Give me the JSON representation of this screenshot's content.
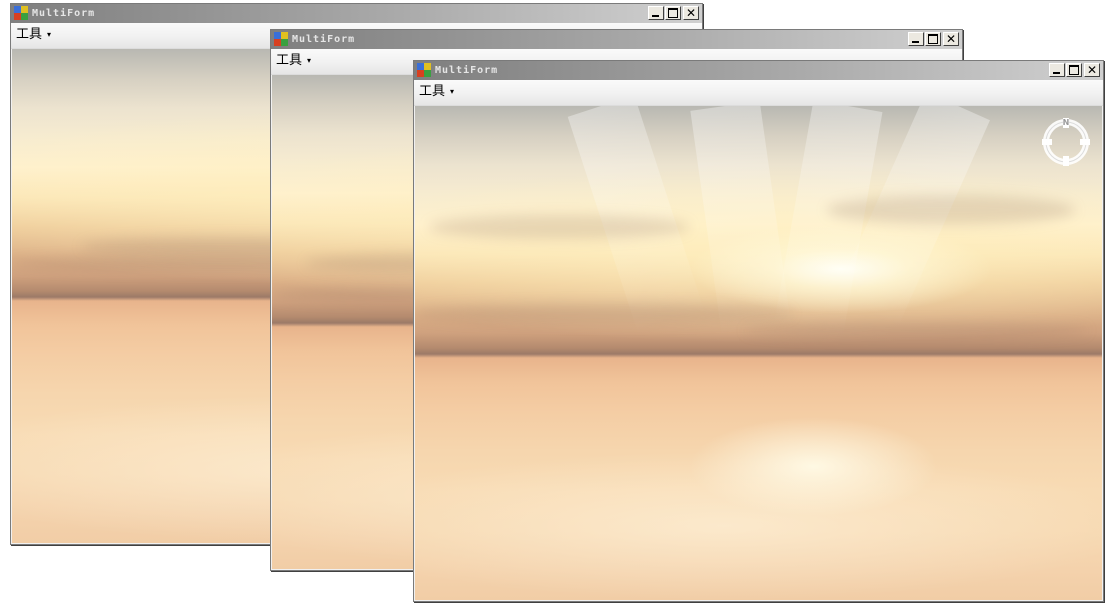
{
  "windows": [
    {
      "title": "MultiForm",
      "menu": {
        "tools_label": "工具"
      },
      "controls": {
        "minimize_glyph": "_",
        "maximize_glyph": "□",
        "close_glyph": "✕"
      }
    },
    {
      "title": "MultiForm",
      "menu": {
        "tools_label": "工具"
      },
      "controls": {
        "minimize_glyph": "_",
        "maximize_glyph": "□",
        "close_glyph": "✕"
      }
    },
    {
      "title": "MultiForm",
      "menu": {
        "tools_label": "工具"
      },
      "controls": {
        "minimize_glyph": "_",
        "maximize_glyph": "□",
        "close_glyph": "✕"
      },
      "compass": {
        "icon": "compass-icon",
        "north_label": "N"
      }
    }
  ],
  "menu_dropdown_glyph": "▾",
  "colors": {
    "titlebar_start": "#7f7f7f",
    "titlebar_end": "#d0d0d0",
    "menubar": "#f0f0f0",
    "horizon": "#9c7a68",
    "sun_glow": "#fff1cf"
  },
  "icons": [
    "app-icon",
    "minimize-icon",
    "maximize-icon",
    "close-icon",
    "dropdown-caret-icon",
    "compass-icon"
  ]
}
